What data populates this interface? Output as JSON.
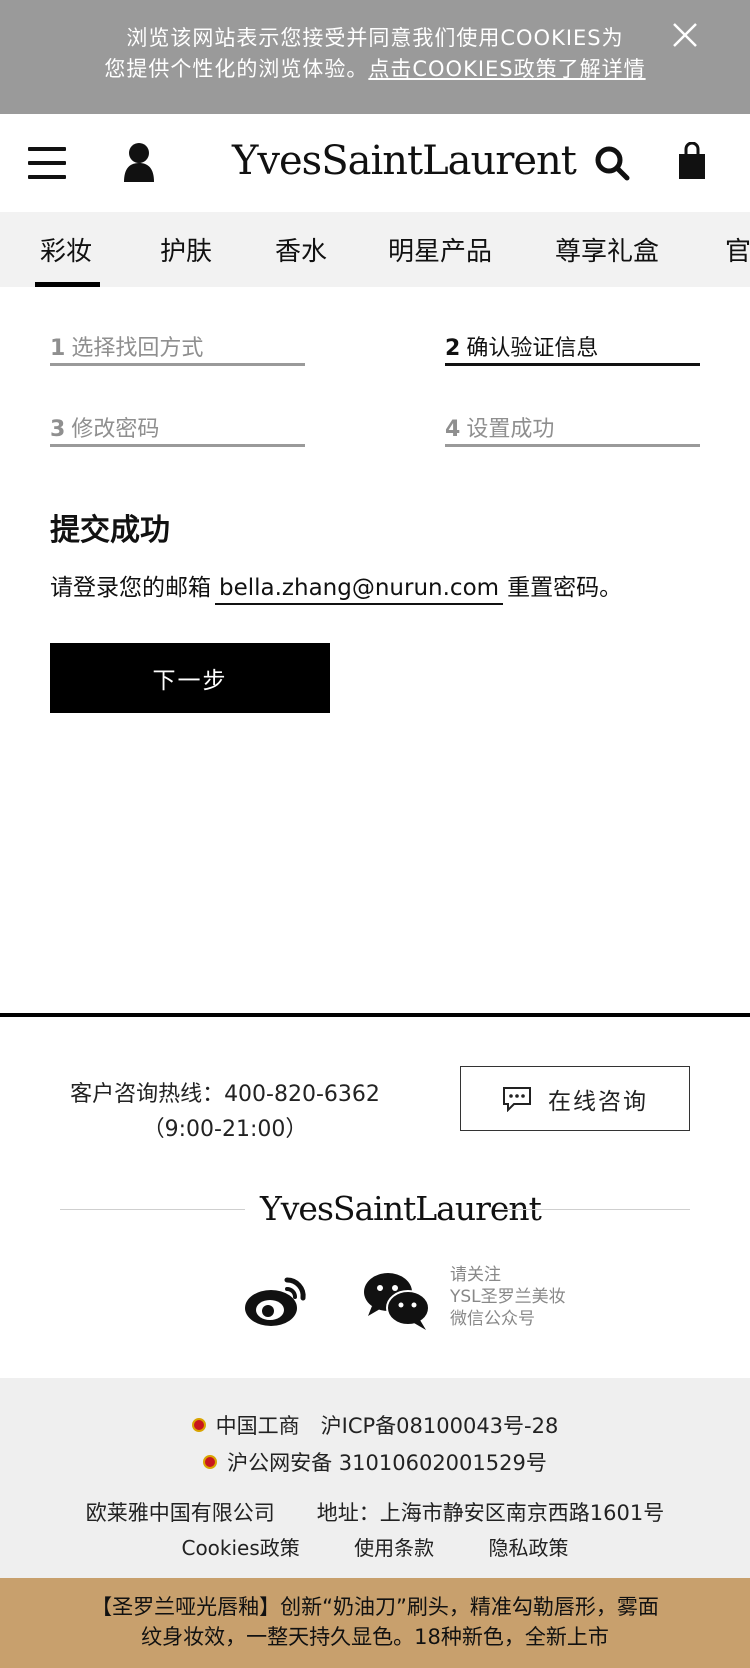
{
  "cookie_banner": {
    "line1": "浏览该网站表示您接受并同意我们使用COOKIES为",
    "line2_prefix": "您提供个性化的浏览体验。",
    "line2_link": "点击COOKIES政策了解详情"
  },
  "header": {
    "logo_text": "YvesSaintLaurent"
  },
  "tabs": [
    "彩妆",
    "护肤",
    "香水",
    "明星产品",
    "尊享礼盒",
    "官"
  ],
  "steps": [
    {
      "num": "1",
      "label": "选择找回方式",
      "state": "inactive"
    },
    {
      "num": "2",
      "label": "确认验证信息",
      "state": "active"
    },
    {
      "num": "3",
      "label": "修改密码",
      "state": "inactive"
    },
    {
      "num": "4",
      "label": "设置成功",
      "state": "inactive"
    }
  ],
  "main": {
    "title": "提交成功",
    "message_prefix": "请登录您的邮箱",
    "email": "bella.zhang@nurun.com",
    "message_suffix": "重置密码。",
    "next_button": "下一步"
  },
  "footer": {
    "hotline_label": "客户咨询热线：400-820-6362",
    "hotline_hours": "（9:00-21:00）",
    "chat_button": "在线咨询",
    "logo_text": "YvesSaintLaurent",
    "follow_lines": [
      "请关注",
      "YSL圣罗兰美妆",
      "微信公众号"
    ],
    "reg_line1": "中国工商　沪ICP备08100043号-28",
    "reg_line2": "沪公网安备 31010602001529号",
    "company_line": "欧莱雅中国有限公司　　地址：上海市静安区南京西路1601号",
    "links": [
      "Cookies政策",
      "使用条款",
      "隐私政策"
    ]
  },
  "promo": {
    "line1": "【圣罗兰哑光唇釉】创新“奶油刀”刷头，精准勾勒唇形，雾面",
    "line2": "纹身妆效，一整天持久显色。18种新色，全新上市"
  },
  "colors": {
    "cookie_bg": "#9a9a9a",
    "tabs_bg": "#f2f2f2",
    "promo_bg": "#c8a06d",
    "button_bg": "#000000"
  }
}
